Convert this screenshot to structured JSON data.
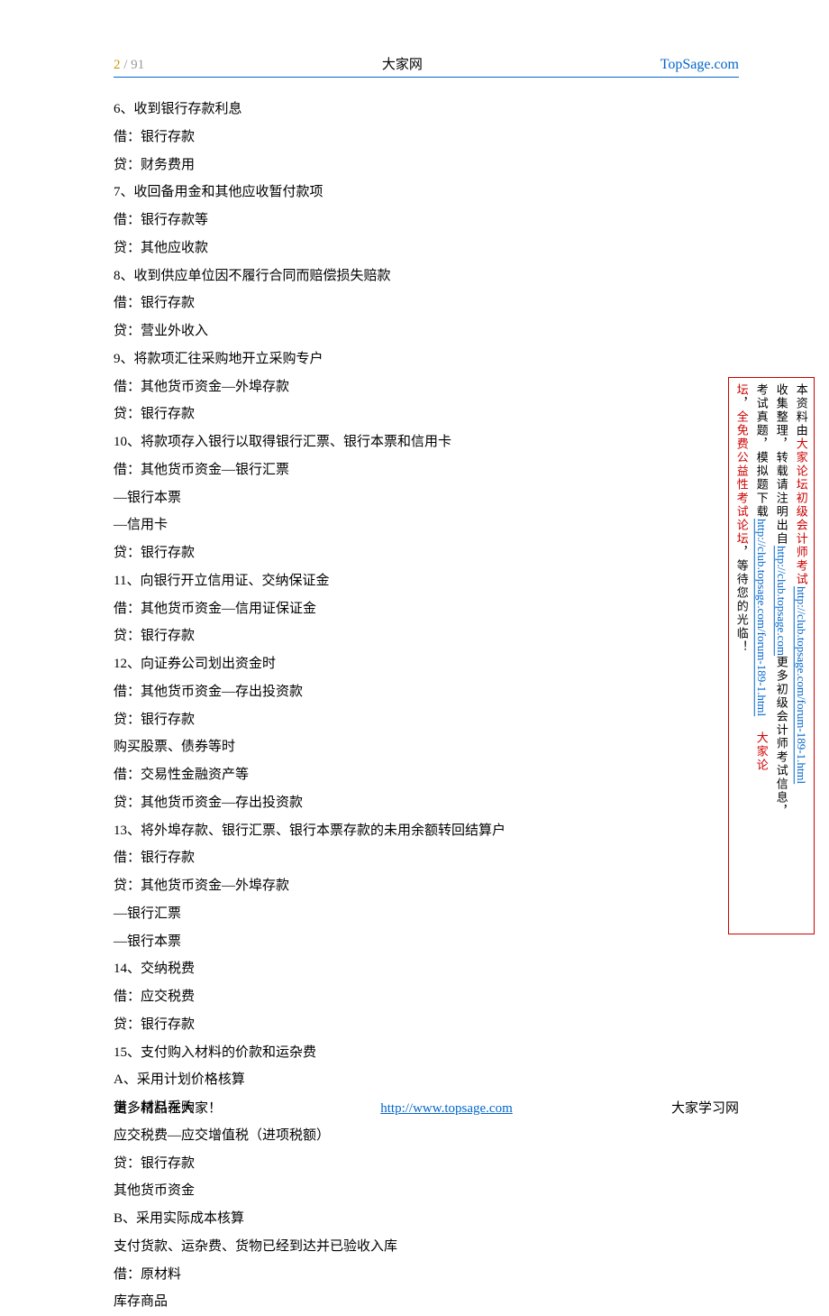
{
  "header": {
    "page_current": "2",
    "page_sep": " / ",
    "page_total": "91",
    "title": "大家网",
    "site": "TopSage.com"
  },
  "sidebar": {
    "col1_a": "本资料由",
    "col1_b": "大家论坛初级会计师考试",
    "col1_link": "http://club.topsage.com/forum-189-1.html",
    "col2_a": "收集整理，转载请注明出自",
    "col2_link": "http://club.topsage.com",
    "col2_b": "更多初级会计师考试信息，",
    "col3_a": "考试真题，模拟题下载",
    "col3_link": "http://club.topsage.com/forum-189-1.html",
    "col3_b": "大家论",
    "col4_a": "坛",
    "col4_b": "，",
    "col4_c": "全免费公益性考试论坛",
    "col4_d": "，等待您的光临！"
  },
  "lines": [
    "6、收到银行存款利息",
    "借：银行存款",
    "贷：财务费用",
    "7、收回备用金和其他应收暂付款项",
    "借：银行存款等",
    "贷：其他应收款",
    "8、收到供应单位因不履行合同而赔偿损失赔款",
    "借：银行存款",
    "贷：营业外收入",
    "9、将款项汇往采购地开立采购专户",
    "借：其他货币资金—外埠存款",
    "贷：银行存款",
    "10、将款项存入银行以取得银行汇票、银行本票和信用卡",
    "借：其他货币资金—银行汇票",
    "—银行本票",
    "—信用卡",
    "贷：银行存款",
    "11、向银行开立信用证、交纳保证金",
    "借：其他货币资金—信用证保证金",
    "贷：银行存款",
    "12、向证券公司划出资金时",
    "借：其他货币资金—存出投资款",
    "贷：银行存款",
    "购买股票、债券等时",
    "借：交易性金融资产等",
    "贷：其他货币资金—存出投资款",
    "13、将外埠存款、银行汇票、银行本票存款的未用余额转回结算户",
    "借：银行存款",
    "贷：其他货币资金—外埠存款",
    "—银行汇票",
    "—银行本票",
    "14、交纳税费",
    "借：应交税费",
    "贷：银行存款",
    "15、支付购入材料的价款和运杂费",
    "A、采用计划价格核算",
    "借：材料采购",
    "应交税费—应交增值税（进项税额）",
    "贷：银行存款",
    "其他货币资金",
    "B、采用实际成本核算",
    "支付货款、运杂费、货物已经到达并已验收入库",
    "借：原材料",
    "库存商品"
  ],
  "footer": {
    "left": "更多精品在大家！",
    "mid": "http://www.topsage.com",
    "right": "大家学习网"
  }
}
